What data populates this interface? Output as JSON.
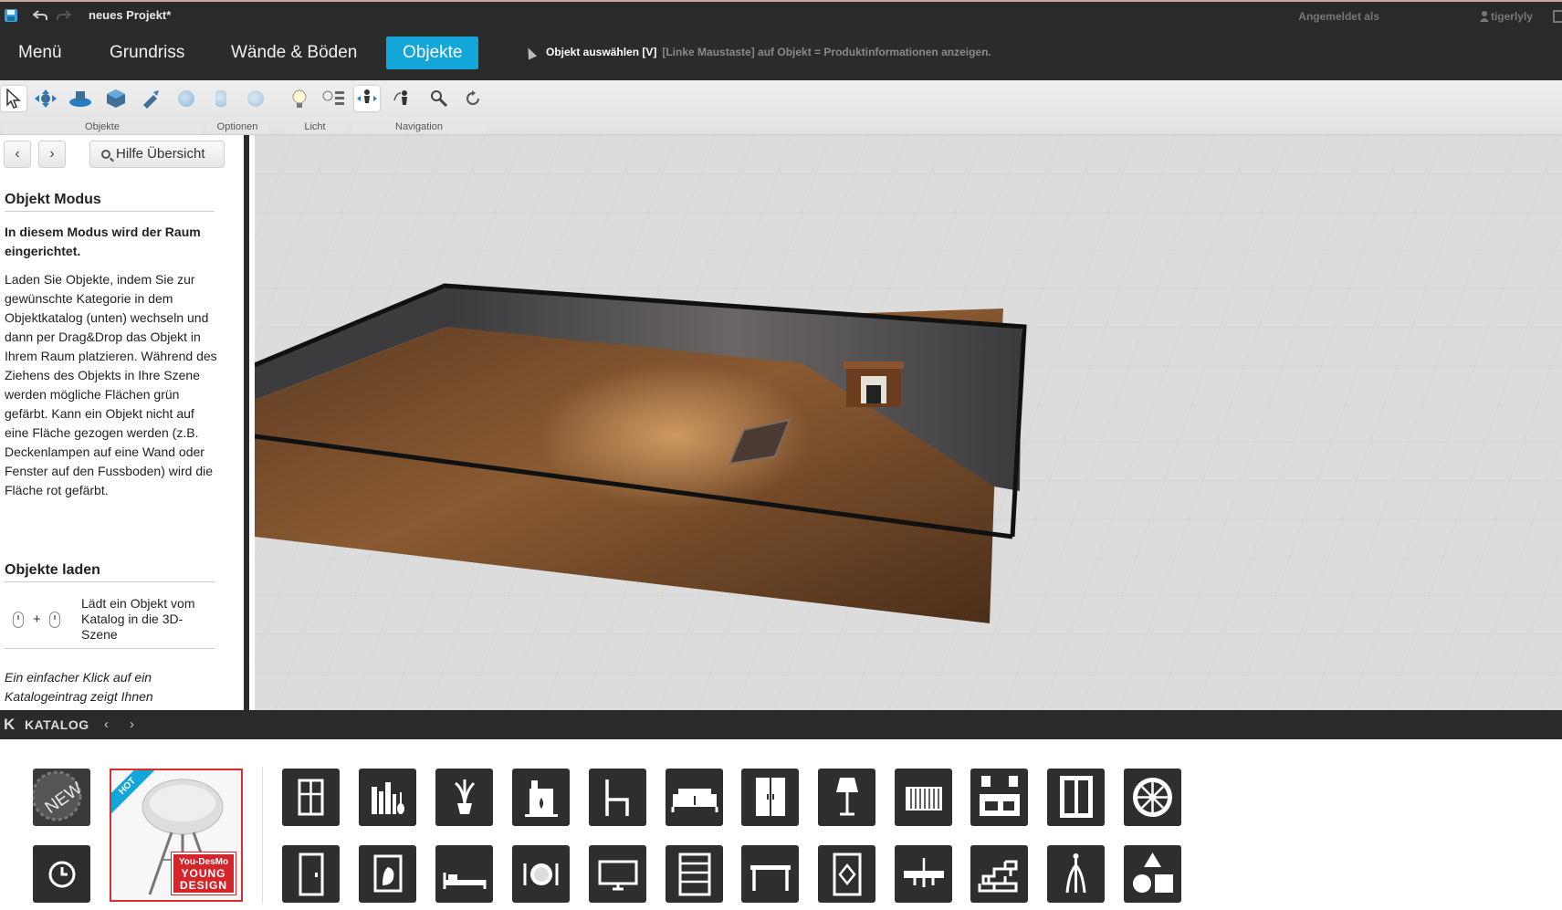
{
  "titlebar": {
    "project_name": "neues Projekt*",
    "login_label": "Angemeldet als",
    "username": "tigerlyly"
  },
  "nav": {
    "tabs": [
      {
        "label": "Menü"
      },
      {
        "label": "Grundriss"
      },
      {
        "label": "Wände & Böden"
      },
      {
        "label": "Objekte",
        "active": true
      }
    ],
    "hint_title": "Objekt auswählen [V]",
    "hint_text": "[Linke Maustaste] auf Objekt = Produktinformationen anzeigen."
  },
  "toolbar": {
    "groups": [
      "Objekte",
      "Optionen",
      "Licht",
      "Navigation"
    ]
  },
  "help": {
    "button_label": "Hilfe Übersicht",
    "prev": "‹",
    "next": "›",
    "section1_title": "Objekt Modus",
    "section1_lead": "In diesem Modus wird der Raum eingerichtet.",
    "section1_body": "Laden Sie Objekte, indem Sie zur gewünschte Kategorie in dem Objektkatalog (unten) wechseln und dann per Drag&Drop das Objekt in Ihrem Raum platzieren. Während des Ziehens des Objekts in Ihre Szene werden mögliche Flächen grün gefärbt. Kann ein Objekt nicht auf eine Fläche gezogen werden (z.B. Deckenlampen auf eine Wand oder Fenster auf den Fussboden) wird die Fläche rot gefärbt.",
    "section2_title": "Objekte laden",
    "section2_item": "Lädt ein Objekt vom Katalog in die 3D-Szene",
    "section2_note": "Ein einfacher Klick auf ein Katalogeintrag zeigt Ihnen"
  },
  "catalog": {
    "title": "KATALOG",
    "k_glyph": "K",
    "prev": "‹",
    "next": "›",
    "new_label": "NEW",
    "hot_label": "HOT",
    "featured_line1": "You-DesMo",
    "featured_line2": "YOUNG",
    "featured_line3": "DESIGN",
    "categories_row1": [
      "window-icon",
      "bookshelf-icon",
      "plant-icon",
      "fireplace-icon",
      "chair-icon",
      "sofa-icon",
      "wardrobe-icon",
      "floor-lamp-icon",
      "radiator-icon",
      "kitchen-icon",
      "window-frame-icon",
      "wheel-icon"
    ],
    "categories_row2": [
      "door-icon",
      "picture-frame-icon",
      "bed-icon",
      "dining-icon",
      "tv-icon",
      "shelf-icon",
      "table-icon",
      "rug-icon",
      "ceiling-lamp-icon",
      "brick-wall-icon",
      "coat-stand-icon",
      "shapes-icon"
    ]
  },
  "colors": {
    "accent": "#12a6d9",
    "dark": "#2a2a2a",
    "hot_red": "#d6242b"
  }
}
